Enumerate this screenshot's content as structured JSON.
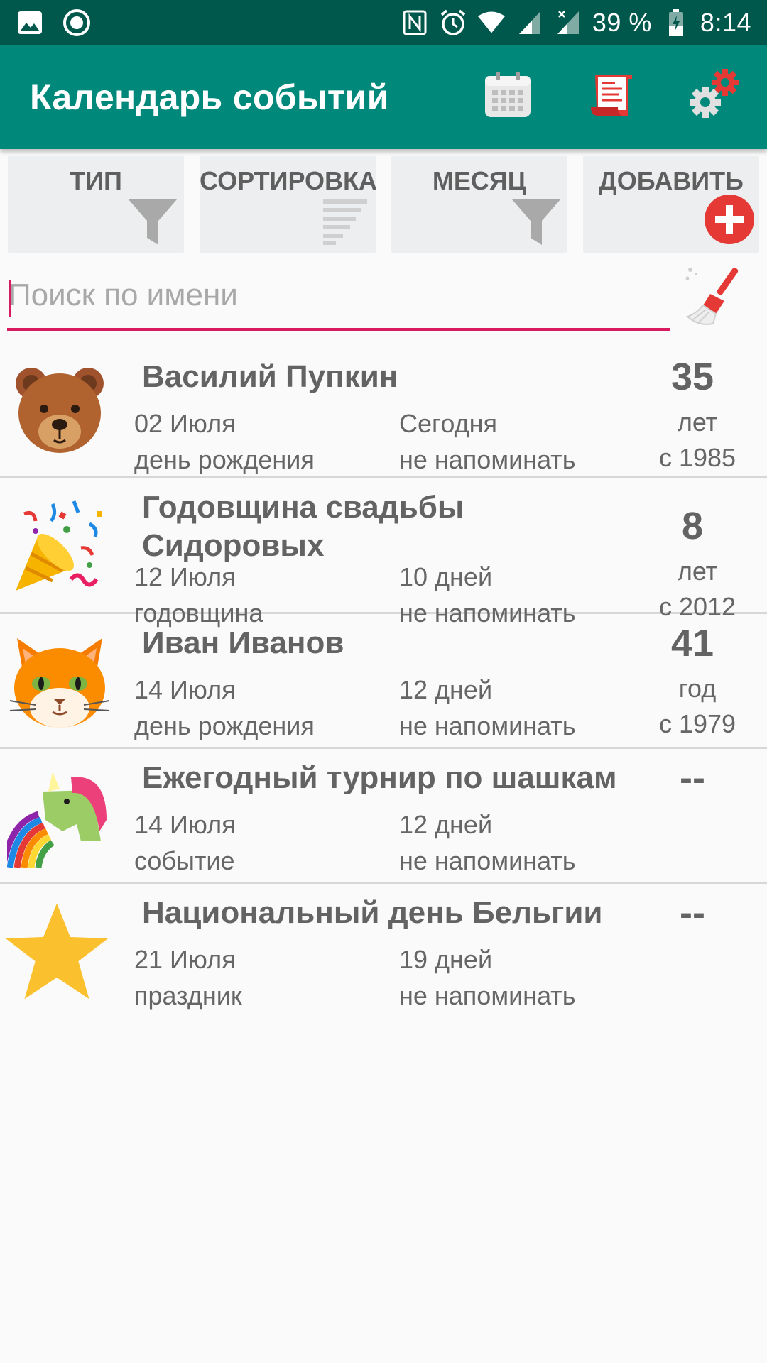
{
  "status_bar": {
    "battery": "39 %",
    "time": "8:14",
    "icons": [
      "image-icon",
      "record-icon",
      "nfc-icon",
      "alarm-icon",
      "wifi-icon",
      "signal-icon",
      "signal-x-icon",
      "battery-charging-icon"
    ]
  },
  "app_bar": {
    "title": "Календарь событий",
    "actions": [
      "calendar-icon",
      "scroll-list-icon",
      "settings-gears-icon"
    ]
  },
  "filters": [
    {
      "label": "ТИП",
      "icon": "filter-icon"
    },
    {
      "label": "СОРТИРОВКА",
      "icon": "sort-lines-icon"
    },
    {
      "label": "МЕСЯЦ",
      "icon": "filter-icon"
    },
    {
      "label": "ДОБАВИТЬ",
      "icon": "add-circle-icon"
    }
  ],
  "search": {
    "placeholder": "Поиск по имени",
    "value": "",
    "clear_icon": "broom-icon"
  },
  "events": [
    {
      "name": "Василий Пупкин",
      "date": "02 Июля",
      "when": "Сегодня",
      "type": "день рождения",
      "reminder": "не напоминать",
      "age": "35",
      "age_unit": "лет",
      "since": "с 1985",
      "avatar": "bear-face-icon"
    },
    {
      "name": "Годовщина свадьбы Сидоровых",
      "date": "12 Июля",
      "when": "10 дней",
      "type": "годовщина",
      "reminder": "не напоминать",
      "age": "8",
      "age_unit": "лет",
      "since": "с 2012",
      "avatar": "party-popper-icon"
    },
    {
      "name": "Иван Иванов",
      "date": "14 Июля",
      "when": "12 дней",
      "type": "день рождения",
      "reminder": "не напоминать",
      "age": "41",
      "age_unit": "год",
      "since": "с 1979",
      "avatar": "cat-face-icon"
    },
    {
      "name": "Ежегодный турнир по шашкам",
      "date": "14 Июля",
      "when": "12 дней",
      "type": "событие",
      "reminder": "не напоминать",
      "age": "--",
      "avatar": "unicorn-rainbow-icon"
    },
    {
      "name": "Национальный день Бельгии",
      "date": "21 Июля",
      "when": "19 дней",
      "type": "праздник",
      "reminder": "не напоминать",
      "age": "--",
      "avatar": "star-icon"
    }
  ],
  "colors": {
    "status_bar": "#00574b",
    "app_bar": "#00897b",
    "accent": "#d81b60",
    "add_button": "#e53935"
  }
}
